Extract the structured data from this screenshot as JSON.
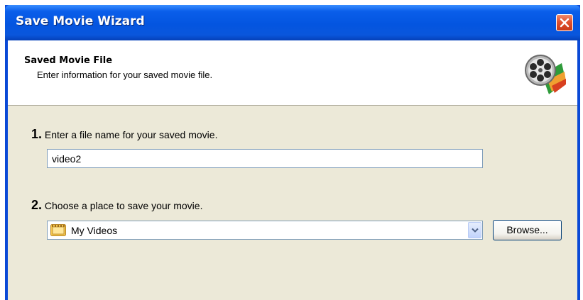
{
  "window": {
    "title": "Save Movie Wizard",
    "close_icon": "close-icon",
    "accent_color": "#0A5EEA",
    "close_color": "#E0512F"
  },
  "header": {
    "title": "Saved Movie File",
    "subtitle": "Enter information for your saved movie file.",
    "logo_icon": "film-reel-icon"
  },
  "step1": {
    "number": "1.",
    "label": "Enter a file name for your saved movie.",
    "filename_value": "video2"
  },
  "step2": {
    "number": "2.",
    "label": "Choose a place to save your movie.",
    "location_value": "My Videos",
    "location_icon": "folder-videos-icon",
    "browse_label": "Browse..."
  }
}
